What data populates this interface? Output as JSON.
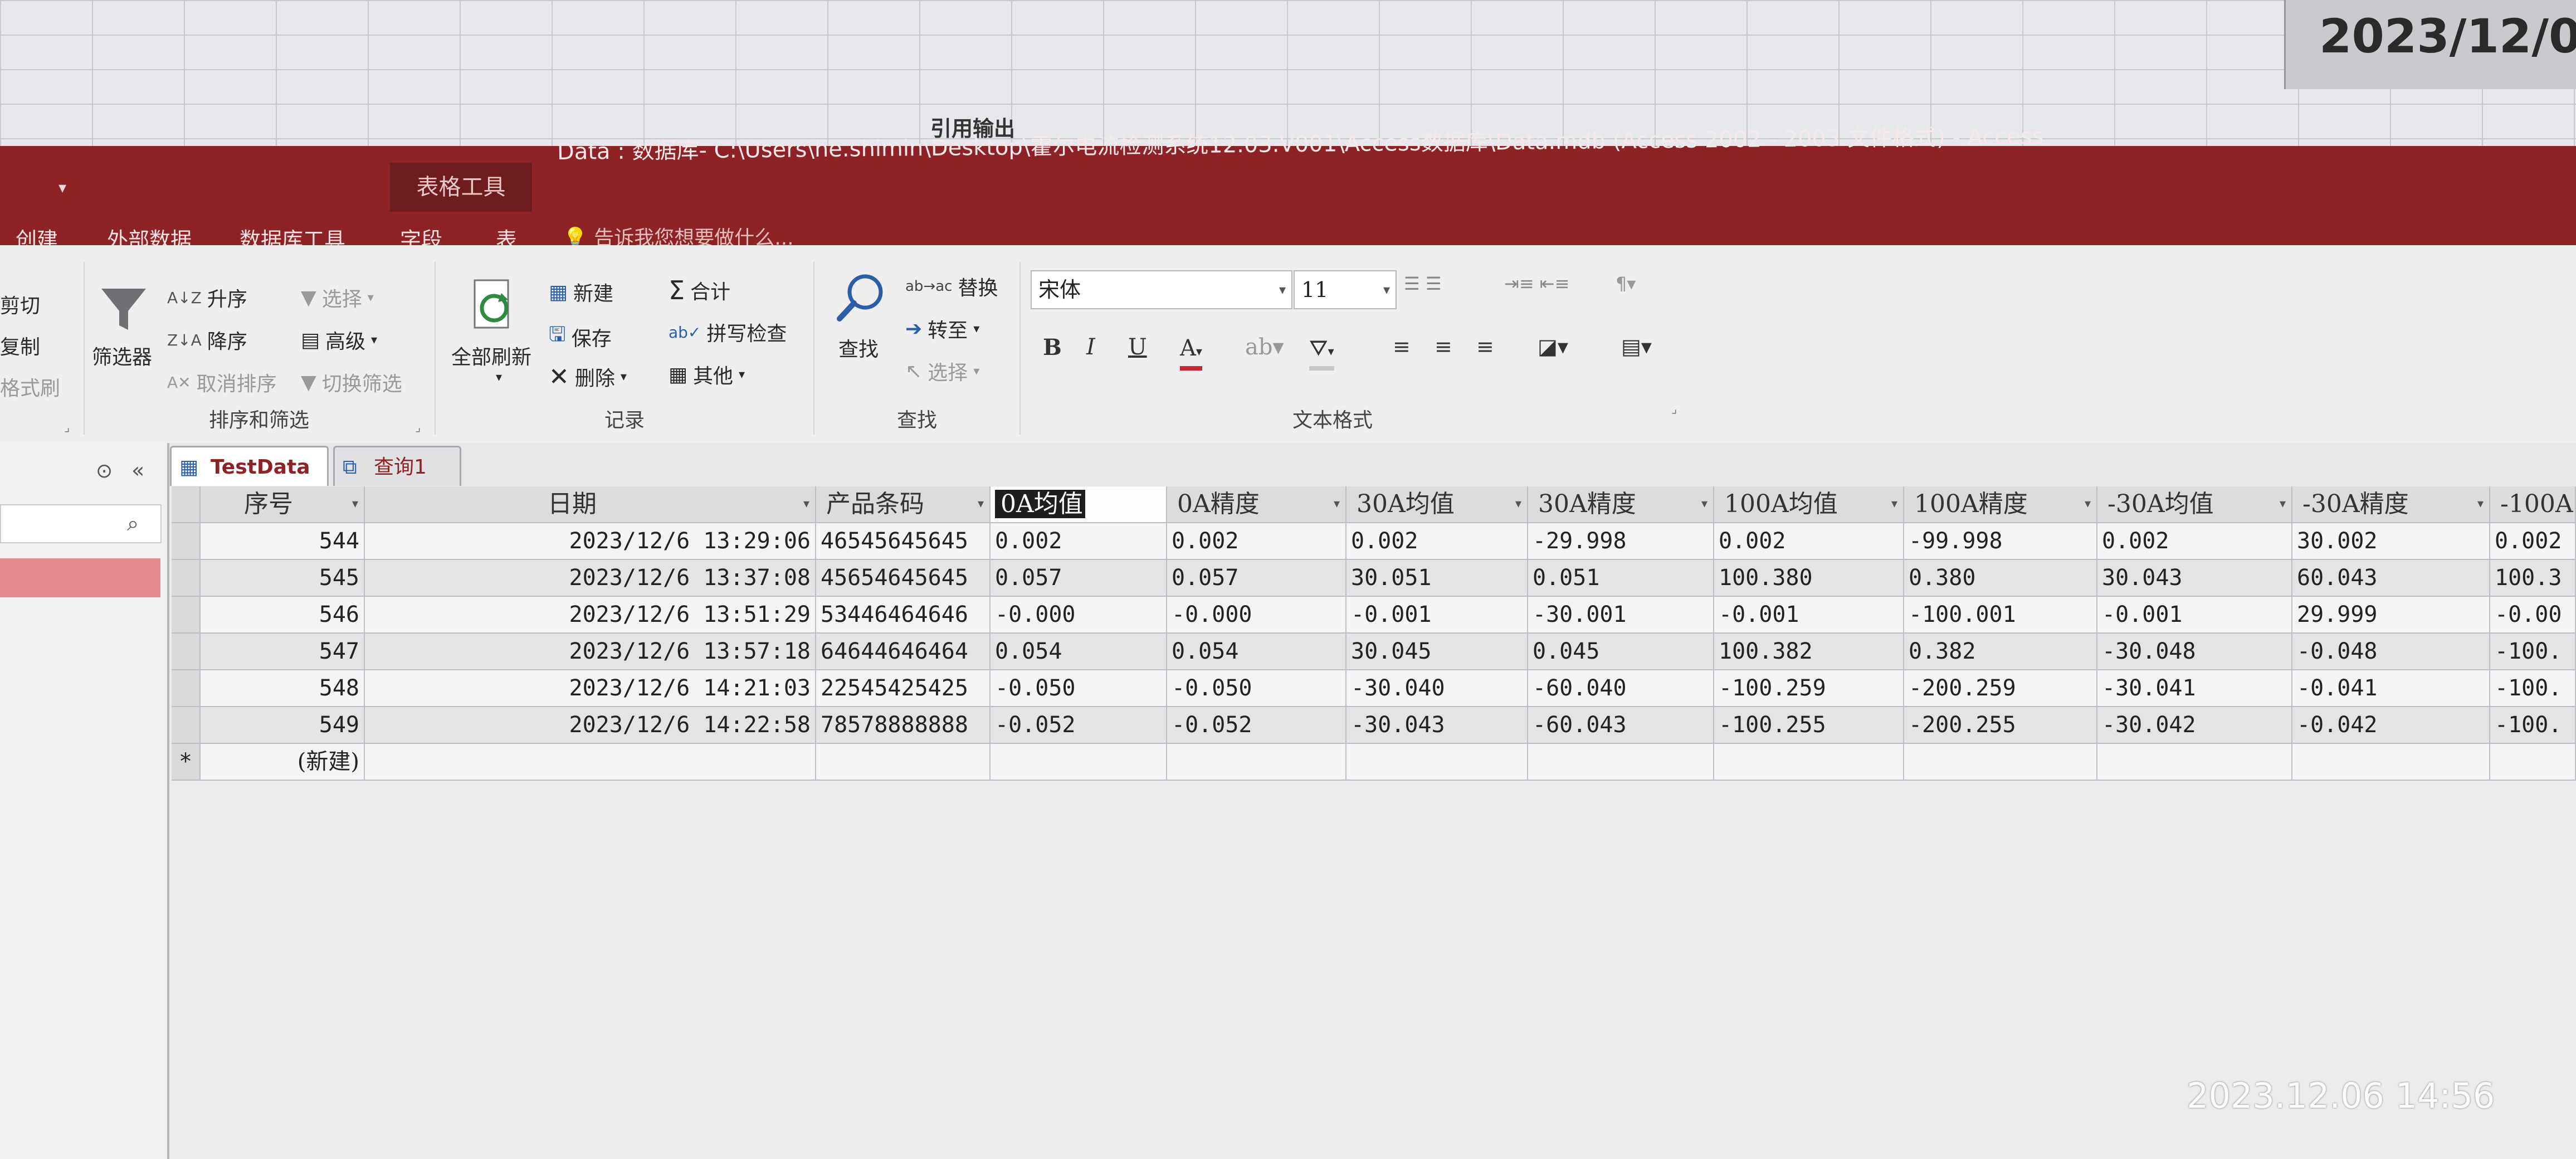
{
  "background": {
    "date_cell": "2023/12/0",
    "sheet_label": "引用输出"
  },
  "window": {
    "table_tools": "表格工具",
    "title": "Data : 数据库- C:\\Users\\he.shimin\\Desktop\\霍尔电流检测系统12.03.V001\\Access数据库\\Data.mdb (Access 2002 - 2003 文件格式) - Access"
  },
  "ribbon_tabs": [
    "创建",
    "外部数据",
    "数据库工具",
    "字段",
    "表"
  ],
  "tell_me": "告诉我您想要做什么...",
  "ribbon": {
    "clipboard": {
      "cut": "剪切",
      "copy": "复制",
      "format_painter": "格式刷"
    },
    "sort_filter": {
      "filter": "筛选器",
      "ascending": "升序",
      "descending": "降序",
      "remove_sort": "取消排序",
      "selection": "选择",
      "advanced": "高级",
      "toggle_filter": "切换筛选",
      "group_label": "排序和筛选"
    },
    "records": {
      "refresh_all": "全部刷新",
      "new": "新建",
      "save": "保存",
      "delete": "删除",
      "totals": "合计",
      "spelling": "拼写检查",
      "more": "其他",
      "group_label": "记录"
    },
    "find": {
      "find": "查找",
      "replace": "替换",
      "goto": "转至",
      "select": "选择",
      "group_label": "查找"
    },
    "text_format": {
      "font_name": "宋体",
      "font_size": "11",
      "bold": "B",
      "italic": "I",
      "underline": "U",
      "group_label": "文本格式"
    }
  },
  "doc_tabs": [
    "TestData",
    "查询1"
  ],
  "table": {
    "columns": [
      "序号",
      "日期",
      "产品条码",
      "0A均值",
      "0A精度",
      "30A均值",
      "30A精度",
      "100A均值",
      "100A精度",
      "-30A均值",
      "-30A精度",
      "-100A"
    ],
    "rows": [
      [
        "544",
        "2023/12/6 13:29:06",
        "46545645645",
        "0.002",
        "0.002",
        "0.002",
        "-29.998",
        "0.002",
        "-99.998",
        "0.002",
        "30.002",
        "0.002"
      ],
      [
        "545",
        "2023/12/6 13:37:08",
        "45654645645",
        "0.057",
        "0.057",
        "30.051",
        "0.051",
        "100.380",
        "0.380",
        "30.043",
        "60.043",
        "100.3"
      ],
      [
        "546",
        "2023/12/6 13:51:29",
        "53446464646",
        "-0.000",
        "-0.000",
        "-0.001",
        "-30.001",
        "-0.001",
        "-100.001",
        "-0.001",
        "29.999",
        "-0.00"
      ],
      [
        "547",
        "2023/12/6 13:57:18",
        "64644646464",
        "0.054",
        "0.054",
        "30.045",
        "0.045",
        "100.382",
        "0.382",
        "-30.048",
        "-0.048",
        "-100."
      ],
      [
        "548",
        "2023/12/6 14:21:03",
        "22545425425",
        "-0.050",
        "-0.050",
        "-30.040",
        "-60.040",
        "-100.259",
        "-200.259",
        "-30.041",
        "-0.041",
        "-100."
      ],
      [
        "549",
        "2023/12/6 14:22:58",
        "78578888888",
        "-0.052",
        "-0.052",
        "-30.043",
        "-60.043",
        "-100.255",
        "-200.255",
        "-30.042",
        "-0.042",
        "-100."
      ]
    ],
    "new_row_marker": "*",
    "new_row_label": "(新建)"
  },
  "photo_timestamp": "2023.12.06  14:56"
}
